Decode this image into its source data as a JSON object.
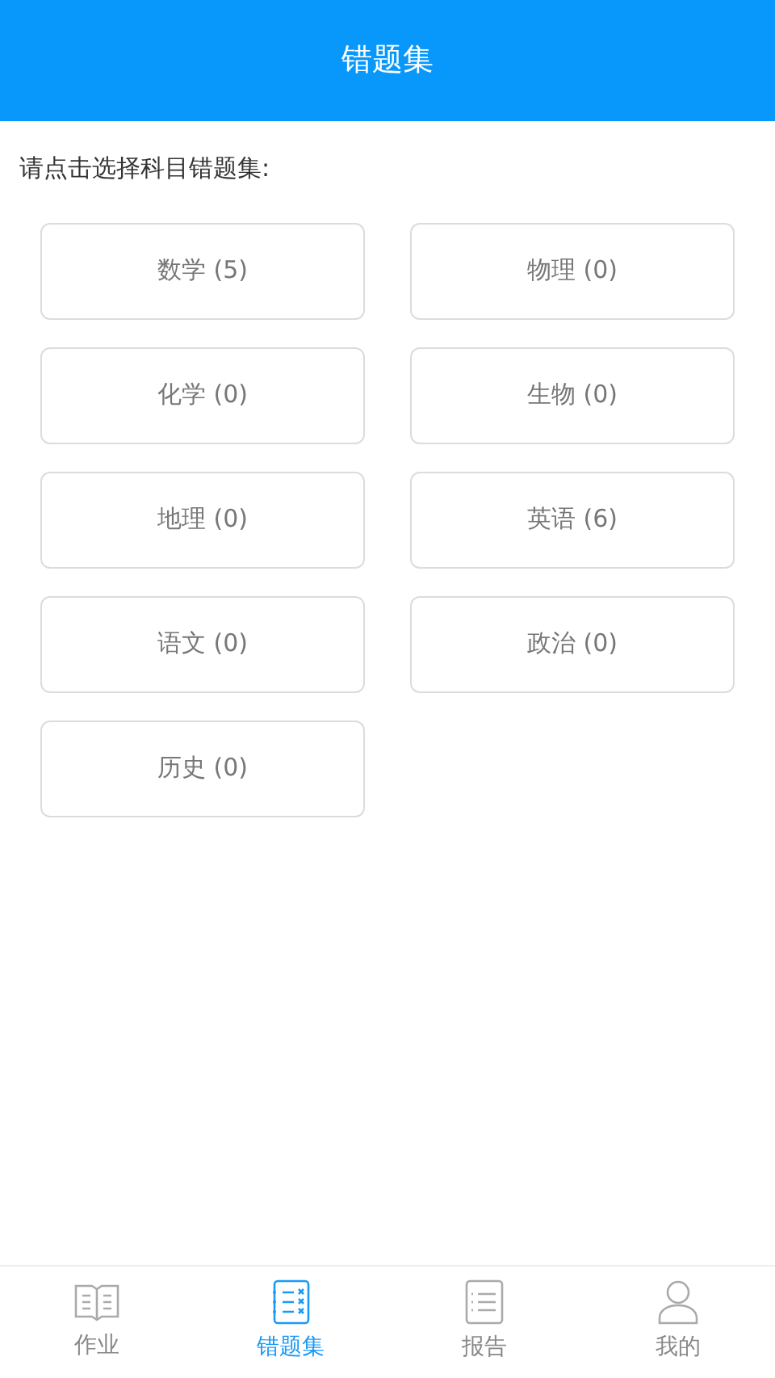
{
  "header": {
    "title": "错题集"
  },
  "prompt": "请点击选择科目错题集:",
  "subjects": [
    {
      "label": "数学 (5)"
    },
    {
      "label": "物理 (0)"
    },
    {
      "label": "化学 (0)"
    },
    {
      "label": "生物 (0)"
    },
    {
      "label": "地理 (0)"
    },
    {
      "label": "英语 (6)"
    },
    {
      "label": "语文 (0)"
    },
    {
      "label": "政治 (0)"
    },
    {
      "label": "历史 (0)"
    }
  ],
  "tabs": [
    {
      "label": "作业",
      "selected": false
    },
    {
      "label": "错题集",
      "selected": true
    },
    {
      "label": "报告",
      "selected": false
    },
    {
      "label": "我的",
      "selected": false
    }
  ]
}
